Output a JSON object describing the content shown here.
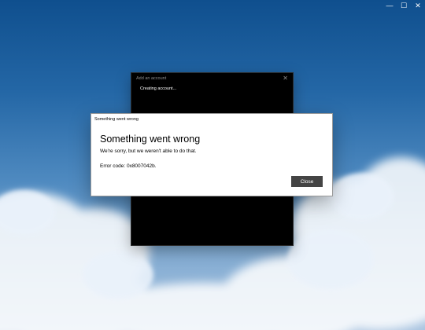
{
  "window_controls": {
    "minimize_glyph": "—",
    "maximize_glyph": "☐",
    "close_glyph": "✕"
  },
  "account_window": {
    "title": "Add an account",
    "close_glyph": "✕",
    "status": "Creating account..."
  },
  "error_dialog": {
    "titlebar": "Something went wrong",
    "heading": "Something went wrong",
    "message": "We're sorry, but we weren't able to do that.",
    "error_code": "Error code: 0x8007042b.",
    "close_label": "Close"
  },
  "colors": {
    "sky_top": "#0f4f8e",
    "sky_bottom": "#a9c4e0",
    "dialog_bg": "#ffffff",
    "button_bg": "#444444",
    "background_window": "#000000"
  }
}
